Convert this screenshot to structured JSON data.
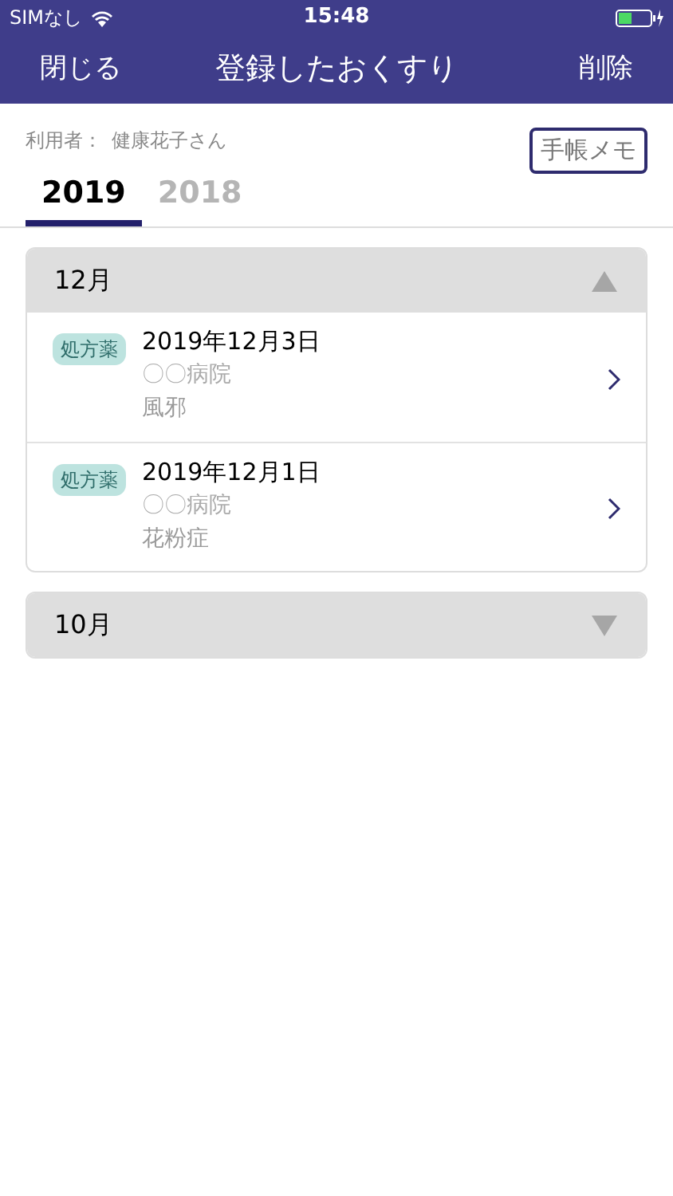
{
  "status_bar": {
    "carrier": "SIMなし",
    "time": "15:48"
  },
  "nav": {
    "left": "閉じる",
    "title": "登録したおくすり",
    "right": "削除"
  },
  "user": {
    "label": "利用者：",
    "name": "健康花子さん"
  },
  "memo_button": "手帳メモ",
  "tabs": [
    {
      "label": "2019",
      "selected": true
    },
    {
      "label": "2018",
      "selected": false
    }
  ],
  "sections": [
    {
      "month": "12月",
      "expanded": true,
      "entries": [
        {
          "badge": "処方薬",
          "date": "2019年12月3日",
          "hospital": "〇〇病院",
          "condition": "風邪"
        },
        {
          "badge": "処方薬",
          "date": "2019年12月1日",
          "hospital": "〇〇病院",
          "condition": "花粉症"
        }
      ]
    },
    {
      "month": "10月",
      "expanded": false
    }
  ]
}
